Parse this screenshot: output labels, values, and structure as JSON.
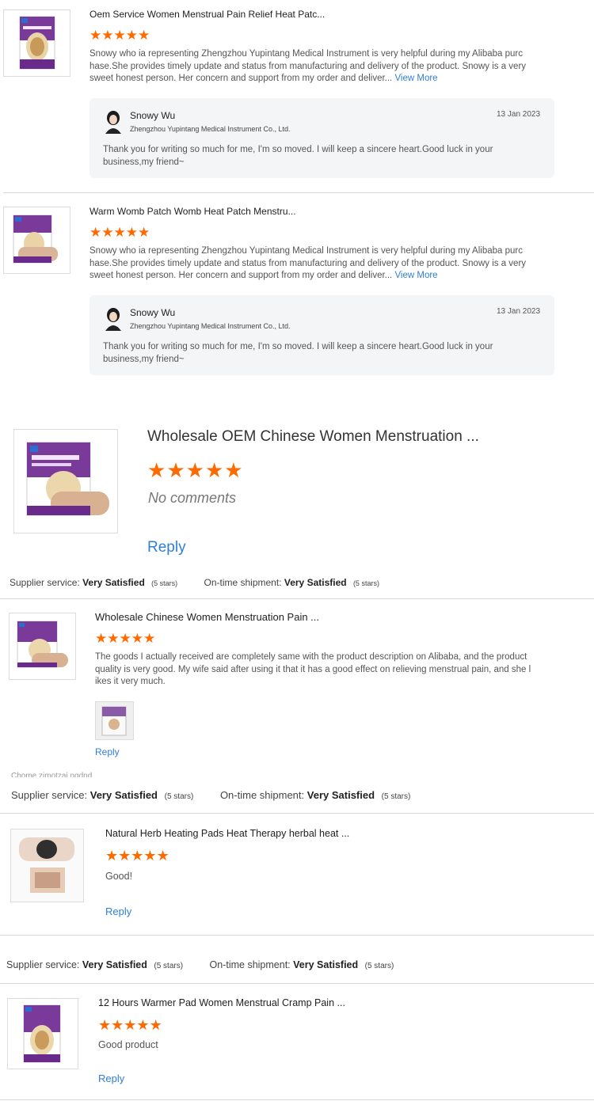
{
  "reviews": [
    {
      "title": "Oem Service Women Menstrual Pain Relief Heat Patc...",
      "stars": 5,
      "text": "Snowy who ia representing Zhengzhou Yupintang Medical Instrument is very helpful during my Alibaba purchase.She provides timely update and status from manufacturing and delivery of the product. Snowy is a very sweet honest person. Her concern and support from my order and deliver...",
      "view_more": "View More",
      "reply": {
        "name": "Snowy Wu",
        "company": "Zhengzhou Yupintang Medical Instrument Co., Ltd.",
        "date": "13 Jan 2023",
        "text": "Thank you for writing so much for me, I'm so moved. I will keep a sincere heart.Good luck in your business,my friend~"
      }
    },
    {
      "title": "Warm Womb Patch Womb Heat Patch Menstru...",
      "stars": 5,
      "text": "Snowy who ia representing Zhengzhou Yupintang Medical Instrument is very helpful during my Alibaba purchase.She provides timely update and status from manufacturing and delivery of the product. Snowy is a very sweet honest person. Her concern and support from my order and deliver...",
      "view_more": "View More",
      "reply": {
        "name": "Snowy Wu",
        "company": "Zhengzhou Yupintang Medical Instrument Co., Ltd.",
        "date": "13 Jan 2023",
        "text": "Thank you for writing so much for me, I'm so moved. I will keep a sincere heart.Good luck in your business,my friend~"
      }
    },
    {
      "title": "Wholesale OEM Chinese Women Menstruation ...",
      "stars": 5,
      "comment": "No comments",
      "reply_label": "Reply",
      "supplier_label": "Supplier service:",
      "supplier_value": "Very Satisfied",
      "supplier_stars": "(5 stars)",
      "shipment_label": "On-time shipment:",
      "shipment_value": "Very Satisfied",
      "shipment_stars": "(5 stars)"
    },
    {
      "title": "Wholesale Chinese Women Menstruation Pain ...",
      "stars": 5,
      "text": "The goods I actually received are completely same with the product description on Alibaba, and the product quality is very good. My wife said after using it that it has a good effect on relieving menstrual pain, and she likes it very much.",
      "reply_label": "Reply",
      "cut_text": "Chome zimotzaj,ngdnd",
      "supplier_label": "Supplier service:",
      "supplier_value": "Very Satisfied",
      "supplier_stars": "(5 stars)",
      "shipment_label": "On-time shipment:",
      "shipment_value": "Very Satisfied",
      "shipment_stars": "(5 stars)"
    },
    {
      "title": "Natural Herb Heating Pads Heat Therapy herbal heat ...",
      "stars": 5,
      "comment": "Good!",
      "reply_label": "Reply",
      "supplier_label": "Supplier service:",
      "supplier_value": "Very Satisfied",
      "supplier_stars": "(5 stars)",
      "shipment_label": "On-time shipment:",
      "shipment_value": "Very Satisfied",
      "shipment_stars": "(5 stars)"
    },
    {
      "title": "12 Hours Warmer Pad Women Menstrual Cramp Pain ...",
      "stars": 5,
      "comment": "Good product",
      "reply_label": "Reply"
    }
  ],
  "colors": {
    "star": "#ff6a00",
    "link": "#2f7fd6",
    "reply_bg": "#f4f5f7",
    "box_purple": "#6a2a8c"
  }
}
